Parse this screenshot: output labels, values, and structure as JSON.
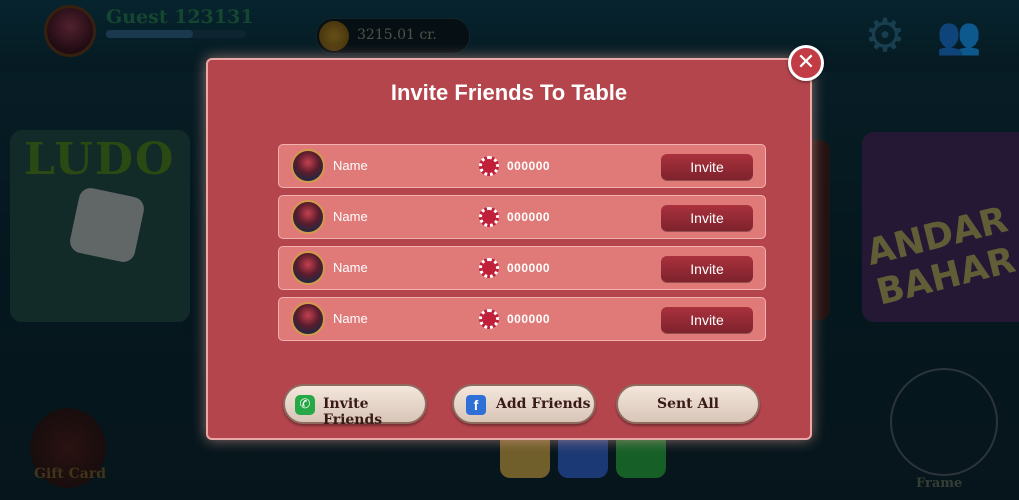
{
  "header": {
    "player_name": "Guest 123131",
    "balance": "3215.01 cr."
  },
  "background": {
    "ludo_title": "LUDO",
    "andar_bahar_label": "ANDAR BAHAR",
    "gift_card_label": "Gift Card",
    "frame_label": "Frame"
  },
  "modal": {
    "title": "Invite Friends To Table",
    "rows": [
      {
        "name": "Name",
        "chips": "000000",
        "action": "Invite"
      },
      {
        "name": "Name",
        "chips": "000000",
        "action": "Invite"
      },
      {
        "name": "Name",
        "chips": "000000",
        "action": "Invite"
      },
      {
        "name": "Name",
        "chips": "000000",
        "action": "Invite"
      }
    ],
    "buttons": {
      "invite_friends": "Invite Friends",
      "add_friends": "Add Friends",
      "sent_all": "Sent All"
    },
    "close_glyph": "✕"
  },
  "icons": {
    "whatsapp": "whatsapp-icon",
    "facebook": "facebook-icon",
    "chip": "poker-chip-icon",
    "close": "close-icon"
  },
  "colors": {
    "modal_bg": "#b5454d",
    "row_bg": "#e07a78",
    "invite_button": "#8e2733"
  }
}
